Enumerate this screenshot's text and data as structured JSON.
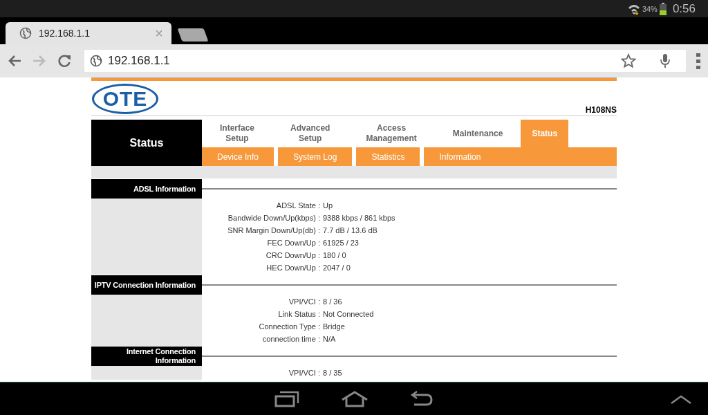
{
  "status_bar": {
    "battery": "34%",
    "time": "0:56"
  },
  "browser": {
    "tabs": [
      {
        "title": "192.168.1.1",
        "close": "×",
        "selected": true
      }
    ],
    "url": "192.168.1.1"
  },
  "page": {
    "logo": "OTE",
    "model": "H108NS",
    "side_title": "Status",
    "menu": [
      {
        "label": "Interface Setup",
        "selected": false
      },
      {
        "label": "Advanced Setup",
        "selected": false
      },
      {
        "label": "Access Management",
        "selected": false
      },
      {
        "label": "Maintenance",
        "selected": false
      },
      {
        "label": "Status",
        "selected": true
      }
    ],
    "submenu": [
      {
        "label": "Device Info"
      },
      {
        "label": "System Log"
      },
      {
        "label": "Statistics"
      },
      {
        "label": "Information"
      }
    ],
    "sections": [
      {
        "title": "ADSL Information",
        "rows": [
          {
            "label": "ADSL State :",
            "value": "Up"
          },
          {
            "label": "Bandwide Down/Up(kbps) :",
            "value": "9388 kbps / 861 kbps"
          },
          {
            "label": "SNR Margin Down/Up(db) :",
            "value": "7.7 dB / 13.6 dB"
          },
          {
            "label": "FEC Down/Up :",
            "value": "61925 / 23"
          },
          {
            "label": "CRC Down/Up :",
            "value": "180 / 0"
          },
          {
            "label": "HEC Down/Up :",
            "value": "2047 / 0"
          }
        ]
      },
      {
        "title": "IPTV Connection Information",
        "rows": [
          {
            "label": "VPI/VCI :",
            "value": "8 / 36"
          },
          {
            "label": "Link Status :",
            "value": "Not Connected"
          },
          {
            "label": "Connection Type :",
            "value": "Bridge"
          },
          {
            "label": "connection time :",
            "value": "N/A"
          }
        ]
      },
      {
        "title": "Internet Connection Information",
        "rows": [
          {
            "label": "VPI/VCI :",
            "value": "8 / 35"
          }
        ]
      }
    ]
  }
}
